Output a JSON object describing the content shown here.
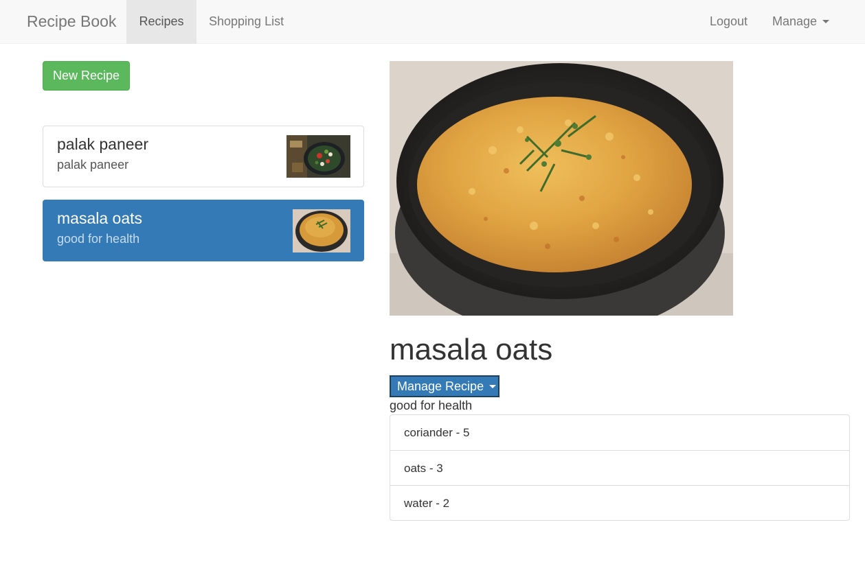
{
  "navbar": {
    "brand": "Recipe Book",
    "links": [
      "Recipes",
      "Shopping List"
    ],
    "right": {
      "logout": "Logout",
      "manage": "Manage"
    }
  },
  "sidebar": {
    "new_button": "New Recipe",
    "recipes": [
      {
        "name": "palak paneer",
        "description": "palak paneer",
        "active": false
      },
      {
        "name": "masala oats",
        "description": "good for health",
        "active": true
      }
    ]
  },
  "detail": {
    "title": "masala oats",
    "manage_button": "Manage Recipe",
    "description": "good for health",
    "ingredients": [
      {
        "label": "coriander - 5"
      },
      {
        "label": "oats - 3"
      },
      {
        "label": "water - 2"
      }
    ]
  },
  "colors": {
    "primary": "#337ab7",
    "success": "#5cb85c",
    "navbar_bg": "#f8f8f8",
    "active_nav_bg": "#e7e7e7"
  }
}
